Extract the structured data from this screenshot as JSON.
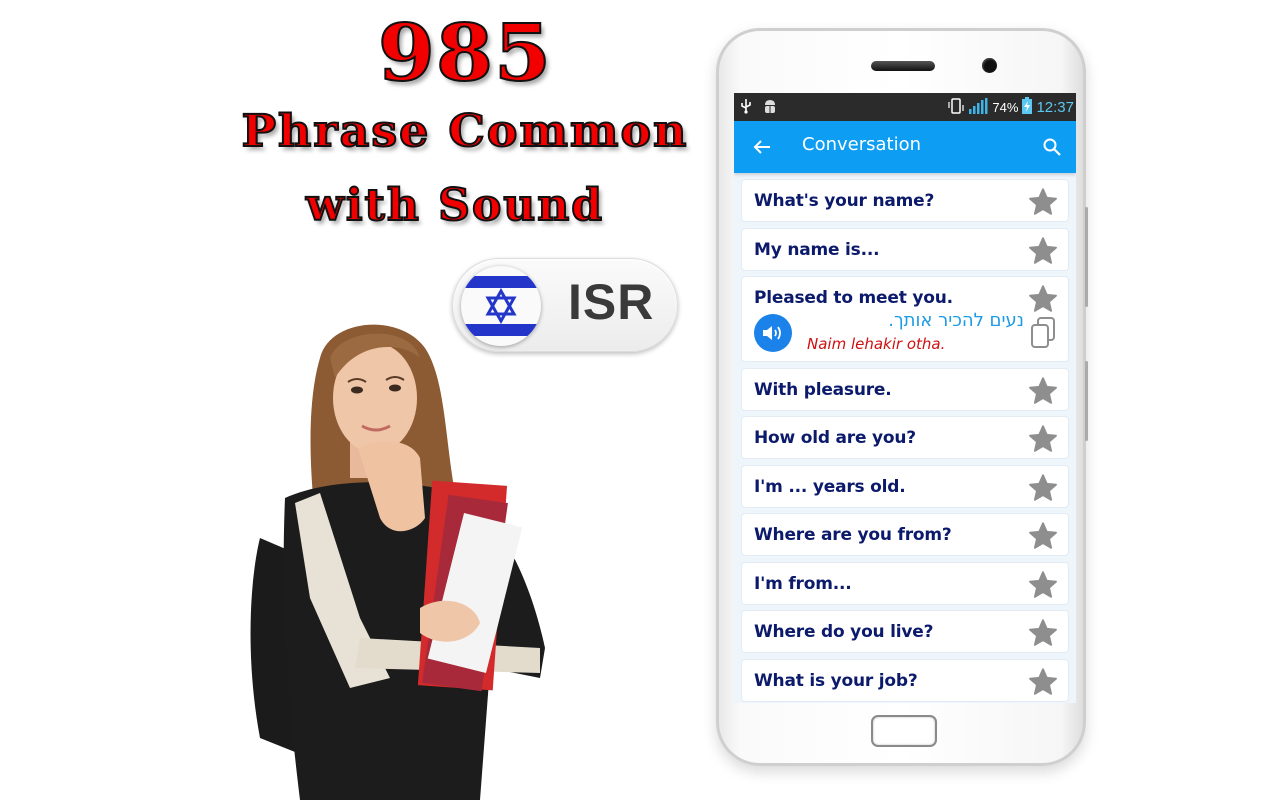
{
  "promo": {
    "count": "985",
    "line1": "Phrase Common",
    "line2": "with Sound",
    "language_code": "ISR",
    "flag_icon": "israel-flag-icon"
  },
  "colors": {
    "headline": "#f20000",
    "app_bar": "#0d9df3",
    "phrase_text": "#0c1a6b",
    "translation_text": "#1d9be6",
    "transliteration_text": "#d01010",
    "star": "#8e8e8e",
    "sound_button": "#1a82e8"
  },
  "status_bar": {
    "icons_left": [
      "usb-icon",
      "android-debug-icon"
    ],
    "icons_right": [
      "vibrate-icon",
      "signal-icon",
      "battery-charging-icon"
    ],
    "battery": "74%",
    "time": "12:37"
  },
  "app_bar": {
    "back_icon": "arrow-left-icon",
    "title": "Conversation",
    "search_icon": "search-icon"
  },
  "phrases": [
    {
      "text": "What's your name?"
    },
    {
      "text": "My name is..."
    },
    {
      "text": "Pleased to meet you.",
      "translation": "נעים להכיר אותך.",
      "transliteration": "Naim lehakir otha.",
      "expanded": true
    },
    {
      "text": "With pleasure."
    },
    {
      "text": "How old are you?"
    },
    {
      "text": "I'm ... years old."
    },
    {
      "text": "Where are you from?"
    },
    {
      "text": "I'm from..."
    },
    {
      "text": "Where do you live?"
    },
    {
      "text": "What is your job?"
    }
  ]
}
